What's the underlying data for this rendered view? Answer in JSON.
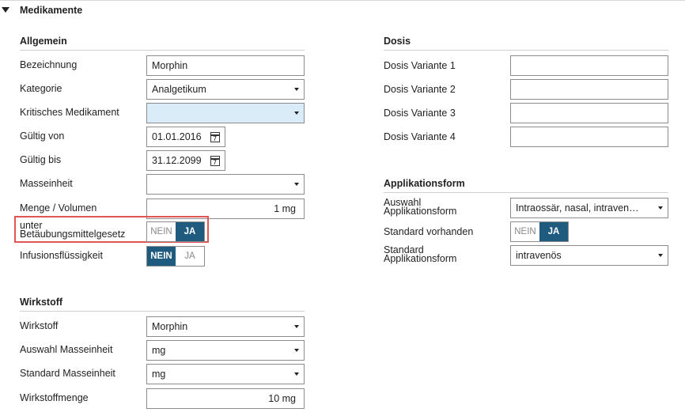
{
  "section": {
    "title": "Medikamente"
  },
  "allgemein": {
    "title": "Allgemein",
    "bezeichnung": {
      "label": "Bezeichnung",
      "value": "Morphin"
    },
    "kategorie": {
      "label": "Kategorie",
      "value": "Analgetikum"
    },
    "kritisches": {
      "label": "Kritisches Medikament",
      "value": ""
    },
    "gueltig_von": {
      "label": "Gültig von",
      "value": "01.01.2016"
    },
    "gueltig_bis": {
      "label": "Gültig bis",
      "value": "31.12.2099"
    },
    "masseinheit": {
      "label": "Masseinheit",
      "value": ""
    },
    "menge": {
      "label": "Menge / Volumen",
      "value": "1 mg"
    },
    "btm": {
      "label_line1": "unter",
      "label_line2": "Betäubungsmittelgesetz",
      "no": "NEIN",
      "yes": "JA",
      "selected": "JA"
    },
    "infusion": {
      "label": "Infusionsflüssigkeit",
      "no": "NEIN",
      "yes": "JA",
      "selected": "NEIN"
    }
  },
  "wirkstoff": {
    "title": "Wirkstoff",
    "wirkstoff": {
      "label": "Wirkstoff",
      "value": "Morphin"
    },
    "auswahl_masseinheit": {
      "label": "Auswahl Masseinheit",
      "value": "mg"
    },
    "standard_masseinheit": {
      "label": "Standard Masseinheit",
      "value": "mg"
    },
    "menge": {
      "label": "Wirkstoffmenge",
      "value": "10 mg"
    }
  },
  "dosis": {
    "title": "Dosis",
    "v1": {
      "label": "Dosis Variante 1",
      "value": ""
    },
    "v2": {
      "label": "Dosis Variante 2",
      "value": ""
    },
    "v3": {
      "label": "Dosis Variante 3",
      "value": ""
    },
    "v4": {
      "label": "Dosis Variante 4",
      "value": ""
    }
  },
  "applikation": {
    "title": "Applikationsform",
    "auswahl": {
      "label_line1": "Auswahl",
      "label_line2": "Applikationsform",
      "value": "Intraossär, nasal, intraven…"
    },
    "vorhanden": {
      "label": "Standard vorhanden",
      "no": "NEIN",
      "yes": "JA",
      "selected": "JA"
    },
    "standard": {
      "label_line1": "Standard",
      "label_line2": "Applikationsform",
      "value": "intravenös"
    }
  },
  "colors": {
    "toggle_active": "#1e5b7f",
    "highlight_field": "#d9ecf8",
    "annotation_box": "#e05555"
  }
}
